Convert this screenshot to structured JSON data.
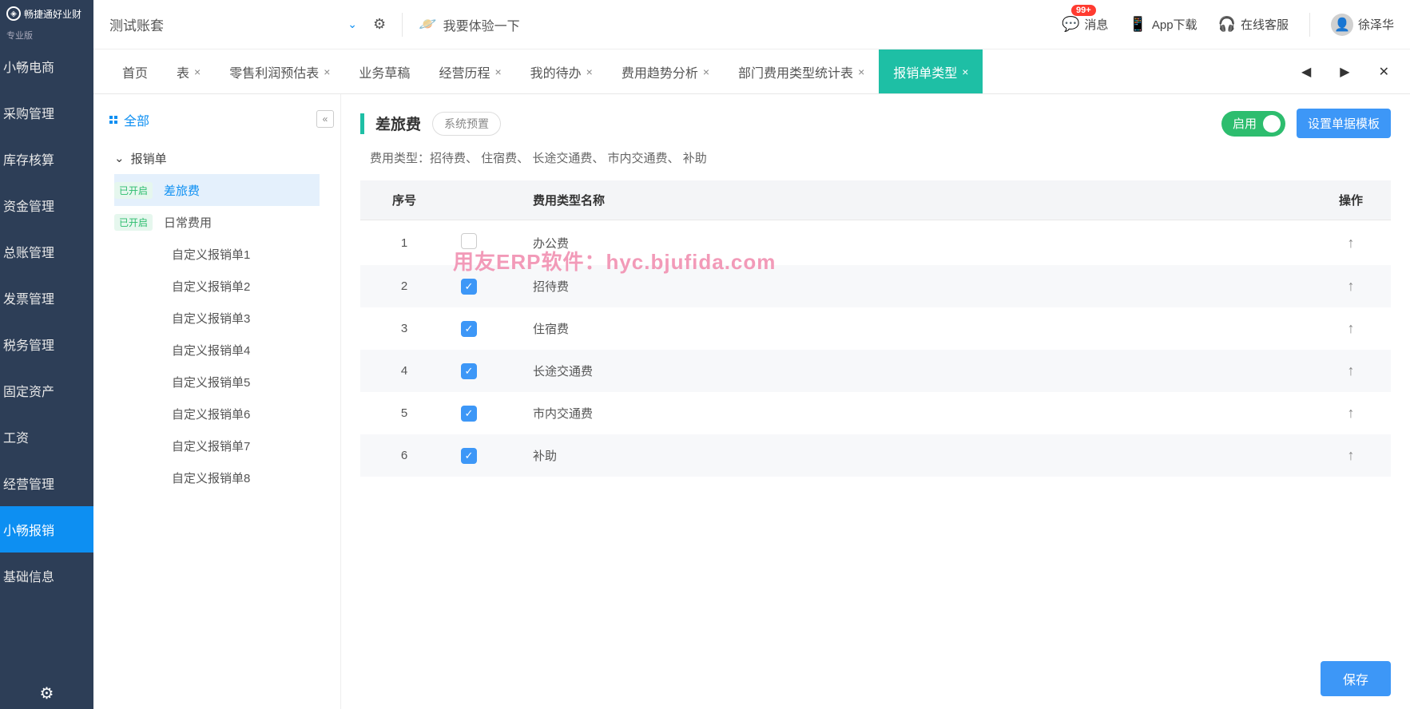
{
  "brand": "畅捷通好业财",
  "edition": "专业版",
  "left_nav": [
    {
      "label": "小畅电商",
      "active": false
    },
    {
      "label": "采购管理",
      "active": false
    },
    {
      "label": "库存核算",
      "active": false
    },
    {
      "label": "资金管理",
      "active": false
    },
    {
      "label": "总账管理",
      "active": false
    },
    {
      "label": "发票管理",
      "active": false
    },
    {
      "label": "税务管理",
      "active": false
    },
    {
      "label": "固定资产",
      "active": false
    },
    {
      "label": "工资",
      "active": false
    },
    {
      "label": "经营管理",
      "active": false
    },
    {
      "label": "小畅报销",
      "active": true
    },
    {
      "label": "基础信息",
      "active": false
    }
  ],
  "account_select": "测试账套",
  "try_label": "我要体验一下",
  "top_right": {
    "msg": "消息",
    "badge": "99+",
    "app": "App下载",
    "online": "在线客服",
    "user": "徐泽华"
  },
  "tabs": [
    {
      "label": "首页",
      "closable": false
    },
    {
      "label": "表",
      "closable": true
    },
    {
      "label": "零售利润预估表",
      "closable": true
    },
    {
      "label": "业务草稿",
      "closable": false
    },
    {
      "label": "经营历程",
      "closable": true
    },
    {
      "label": "我的待办",
      "closable": true
    },
    {
      "label": "费用趋势分析",
      "closable": true
    },
    {
      "label": "部门费用类型统计表",
      "closable": true
    },
    {
      "label": "报销单类型",
      "closable": true,
      "active": true
    }
  ],
  "tree": {
    "all": "全部",
    "group": "报销单",
    "items": [
      {
        "status": "已开启",
        "label": "差旅费",
        "active": true
      },
      {
        "status": "已开启",
        "label": "日常费用"
      },
      {
        "label": "自定义报销单1"
      },
      {
        "label": "自定义报销单2"
      },
      {
        "label": "自定义报销单3"
      },
      {
        "label": "自定义报销单4"
      },
      {
        "label": "自定义报销单5"
      },
      {
        "label": "自定义报销单6"
      },
      {
        "label": "自定义报销单7"
      },
      {
        "label": "自定义报销单8"
      }
    ]
  },
  "detail": {
    "title": "差旅费",
    "sys_tag": "系统预置",
    "toggle_label": "启用",
    "template_btn": "设置单据模板",
    "subtypes_prefix": "费用类型：",
    "subtypes": "招待费、 住宿费、 长途交通费、 市内交通费、 补助",
    "save_btn": "保存",
    "columns": {
      "seq": "序号",
      "name": "费用类型名称",
      "op": "操作"
    },
    "rows": [
      {
        "seq": "1",
        "checked": false,
        "name": "办公费"
      },
      {
        "seq": "2",
        "checked": true,
        "name": "招待费"
      },
      {
        "seq": "3",
        "checked": true,
        "name": "住宿费"
      },
      {
        "seq": "4",
        "checked": true,
        "name": "长途交通费"
      },
      {
        "seq": "5",
        "checked": true,
        "name": "市内交通费"
      },
      {
        "seq": "6",
        "checked": true,
        "name": "补助"
      }
    ]
  },
  "watermark": "用友ERP软件：hyc.bjufida.com"
}
